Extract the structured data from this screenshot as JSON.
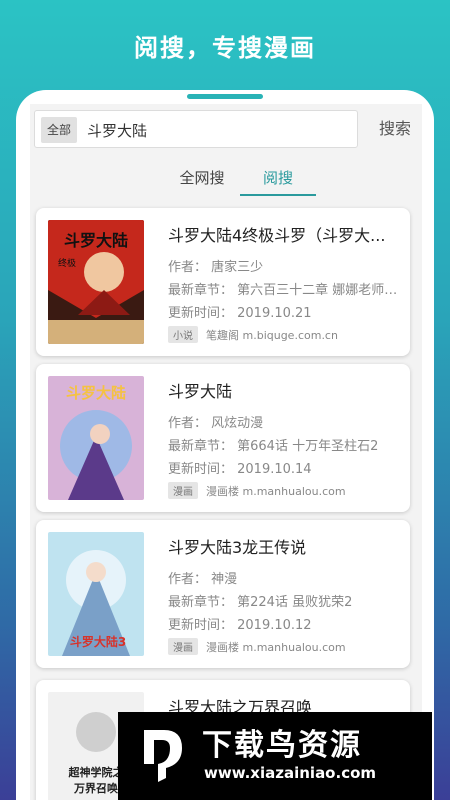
{
  "headline": "阅搜，专搜漫画",
  "search": {
    "scope": "全部",
    "query": "斗罗大陆",
    "button": "搜索"
  },
  "tabs": [
    {
      "label": "全网搜",
      "active": false
    },
    {
      "label": "阅搜",
      "active": true
    }
  ],
  "results": [
    {
      "title": "斗罗大陆4终极斗罗（斗罗大...",
      "author": "作者：  唐家三少",
      "latest": "最新章节：  第六百三十二章 娜娜老师留...",
      "updated": "更新时间：  2019.10.21",
      "badge": "小说",
      "source": "笔趣阁 m.biquge.com.cn"
    },
    {
      "title": "斗罗大陆",
      "author": "作者：  风炫动漫",
      "latest": "最新章节：  第664话 十万年圣柱石2",
      "updated": "更新时间：  2019.10.14",
      "badge": "漫画",
      "source": "漫画楼 m.manhualou.com"
    },
    {
      "title": "斗罗大陆3龙王传说",
      "author": "作者：  神漫",
      "latest": "最新章节：  第224话 虽败犹荣2",
      "updated": "更新时间：  2019.10.12",
      "badge": "漫画",
      "source": "漫画楼 m.manhualou.com"
    },
    {
      "title": "斗罗大陆之万界召唤",
      "author": "",
      "latest": "",
      "updated": "",
      "badge": "",
      "source": ""
    }
  ],
  "covers": [
    {
      "text": "斗罗大陆",
      "vertical": "终极斗罗",
      "colors": [
        "#c5281c",
        "#3a1a12"
      ]
    },
    {
      "text": "斗罗大陆",
      "colors": [
        "#d8b3d8",
        "#5b3a8a"
      ]
    },
    {
      "text": "斗罗大陆3",
      "colors": [
        "#bfe3f0",
        "#7aa0c8"
      ]
    },
    {
      "text": "超神学院之万界召唤",
      "colors": [
        "#f1f1f1",
        "#bcbcbc"
      ]
    }
  ],
  "watermark": {
    "title": "下载鸟资源",
    "url": "www.xiazainiao.com"
  }
}
